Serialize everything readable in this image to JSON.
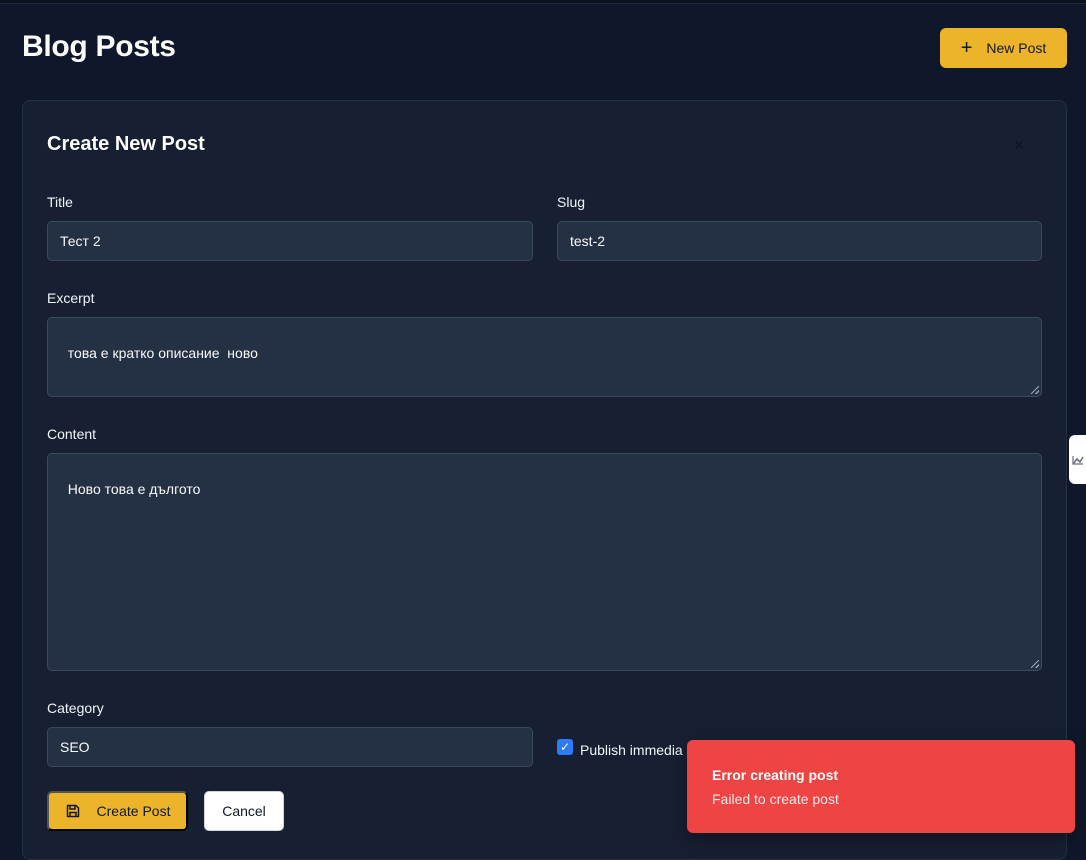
{
  "page": {
    "title": "Blog Posts",
    "new_post_label": "New Post"
  },
  "form": {
    "heading": "Create New Post",
    "title_label": "Title",
    "title_value": "Тест 2",
    "slug_label": "Slug",
    "slug_value": "test-2",
    "excerpt_label": "Excerpt",
    "excerpt_value": "това е кратко описание  ново",
    "content_label": "Content",
    "content_value": "Ново това е дългото",
    "category_label": "Category",
    "category_value": "SEO",
    "publish_label": "Publish immedia",
    "publish_checked": true,
    "create_label": "Create Post",
    "cancel_label": "Cancel"
  },
  "toast": {
    "title": "Error creating post",
    "message": "Failed to create post"
  },
  "colors": {
    "background": "#0f172a",
    "card": "#162032",
    "accent": "#ecb42a",
    "error": "#ef4444",
    "checkbox": "#2f7bf6"
  },
  "icons": {
    "new_post": "plus-icon",
    "create": "save-icon",
    "close": "close-icon",
    "side_tab": "expand-icon"
  }
}
